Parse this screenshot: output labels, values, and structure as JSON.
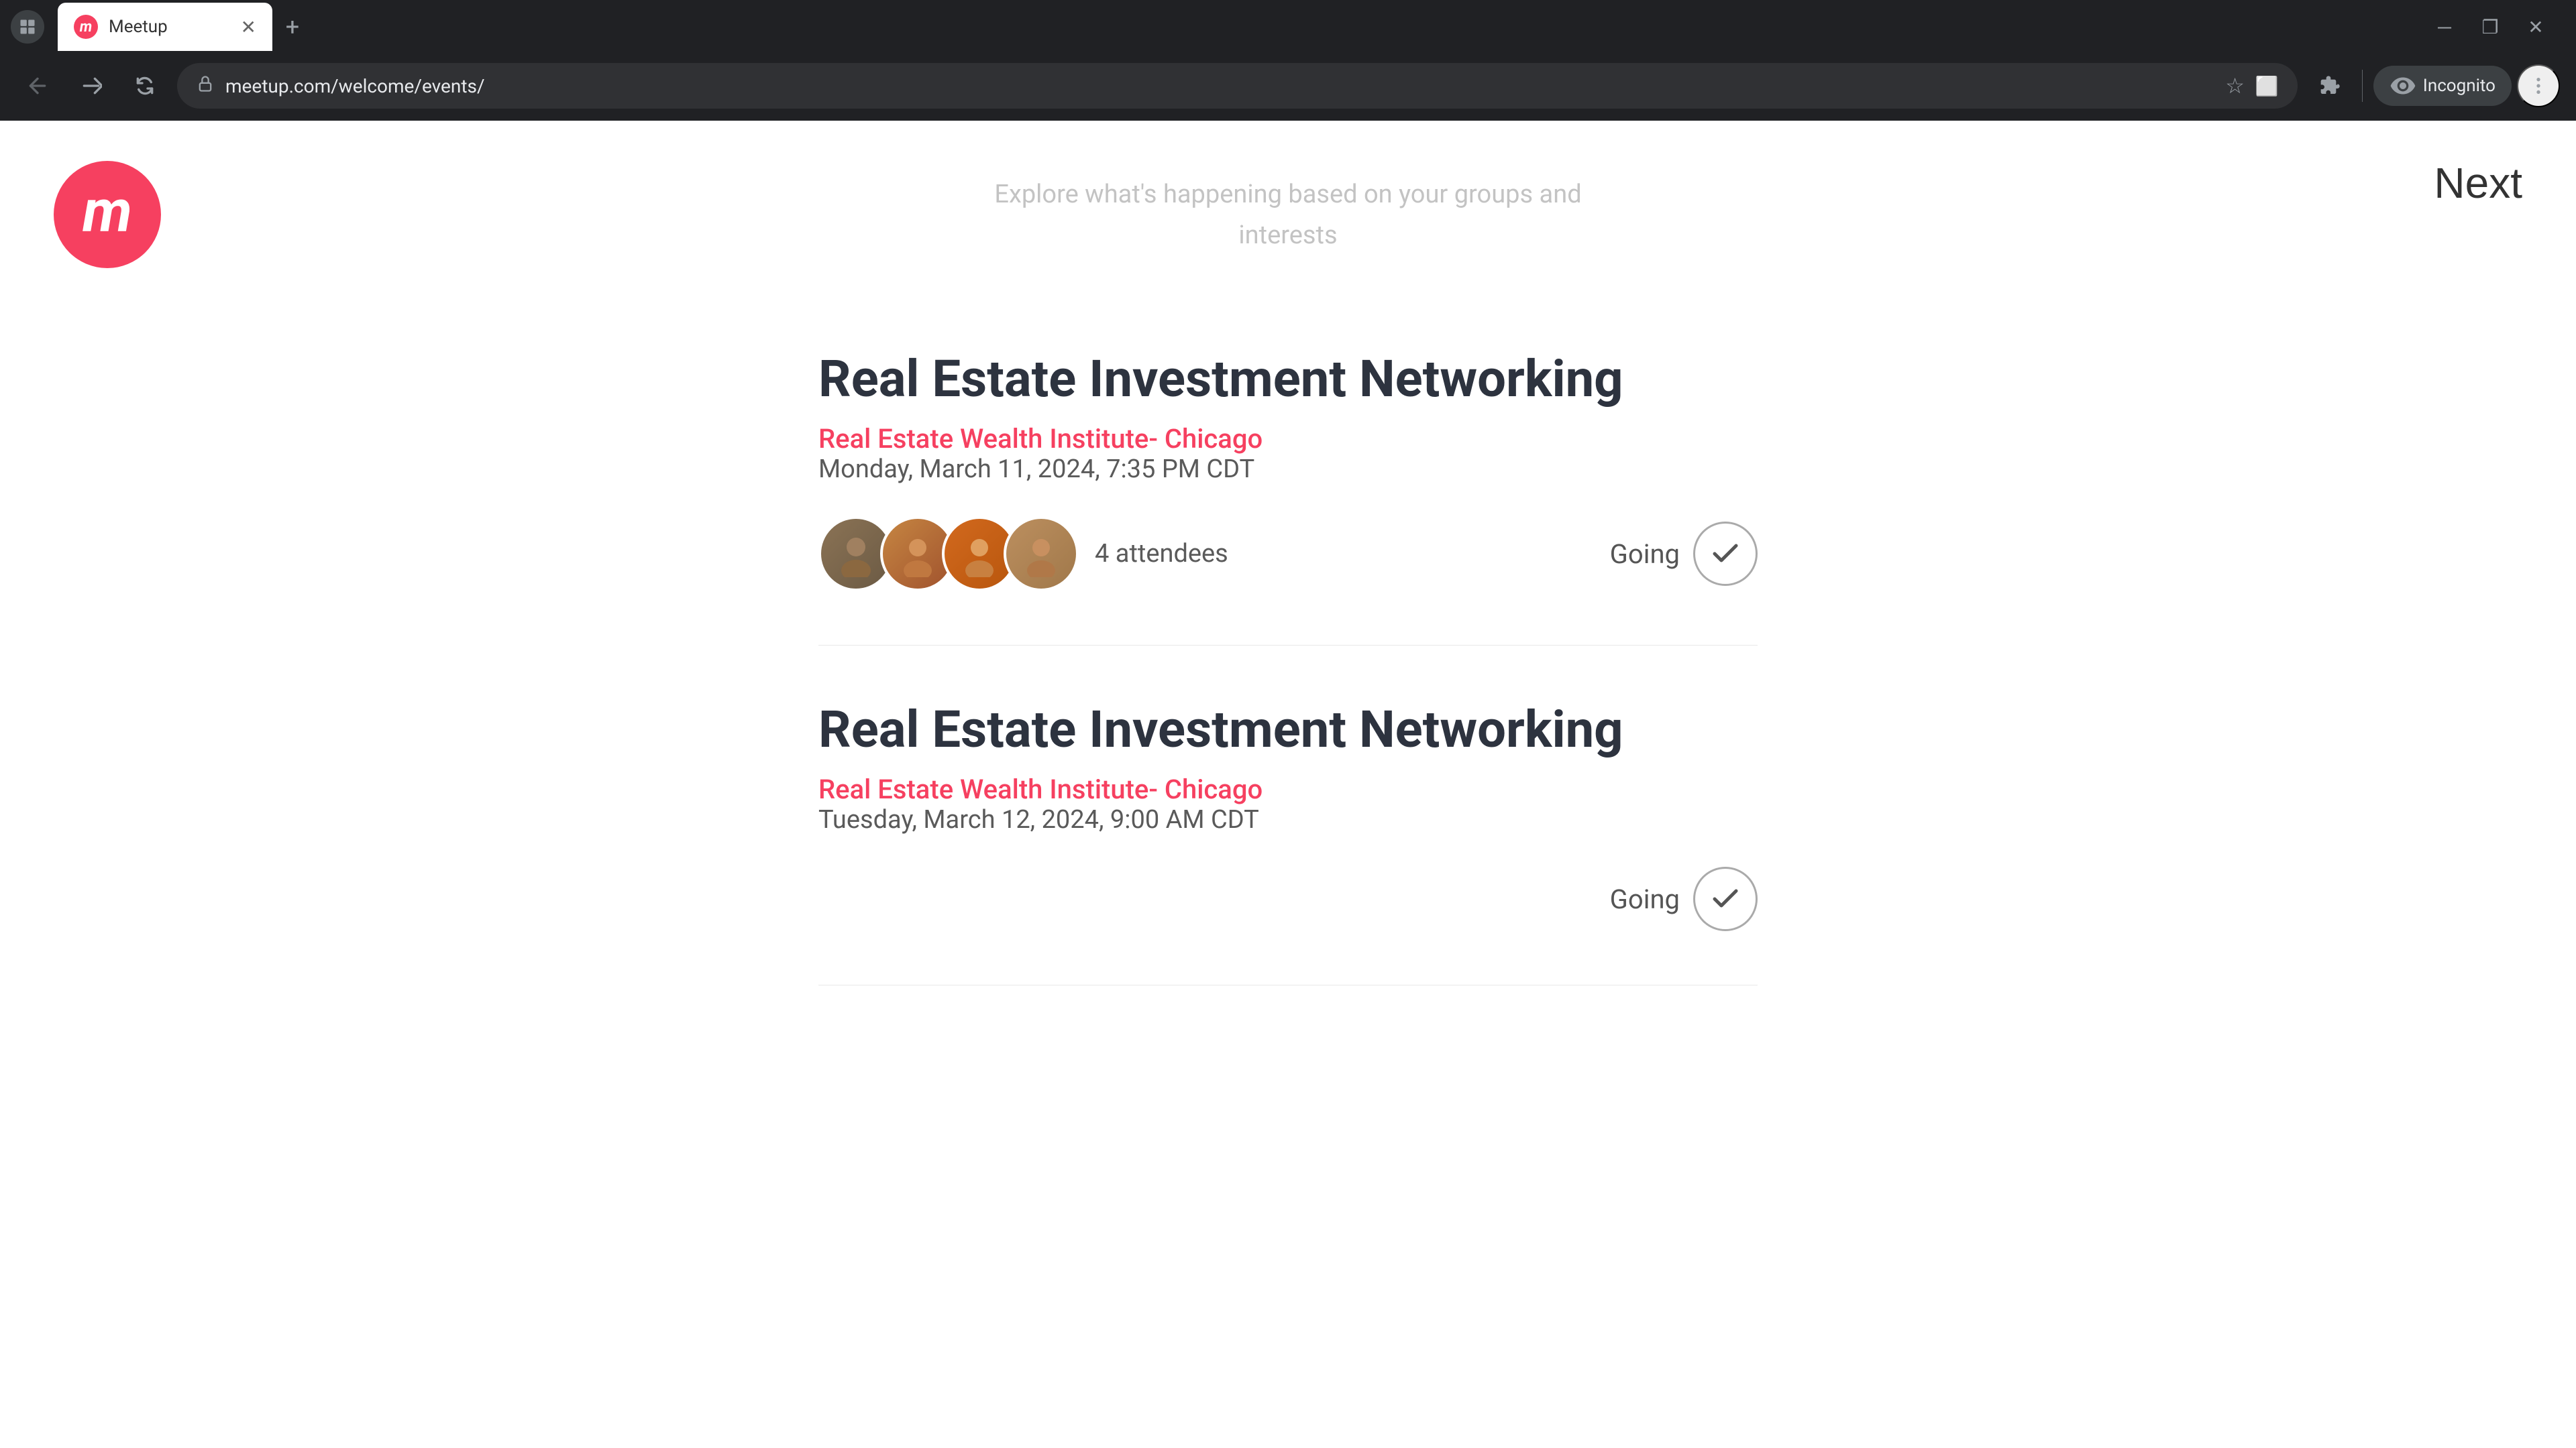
{
  "browser": {
    "tab": {
      "title": "Meetup",
      "favicon": "M"
    },
    "url": "meetup.com/welcome/events/",
    "incognito_label": "Incognito"
  },
  "page": {
    "logo": "m",
    "next_button": "Next",
    "subtitle": "Explore what's happening based on your groups and interests"
  },
  "events": [
    {
      "title": "Real Estate Investment Networking",
      "group": "Real Estate Wealth Institute- Chicago",
      "date": "Monday, March 11, 2024, 7:35 PM CDT",
      "attendees_count": "4 attendees",
      "going": true,
      "going_label": "Going"
    },
    {
      "title": "Real Estate Investment Networking",
      "group": "Real Estate Wealth Institute- Chicago",
      "date": "Tuesday, March 12, 2024, 9:00 AM CDT",
      "attendees_count": "",
      "going": true,
      "going_label": "Going"
    }
  ]
}
